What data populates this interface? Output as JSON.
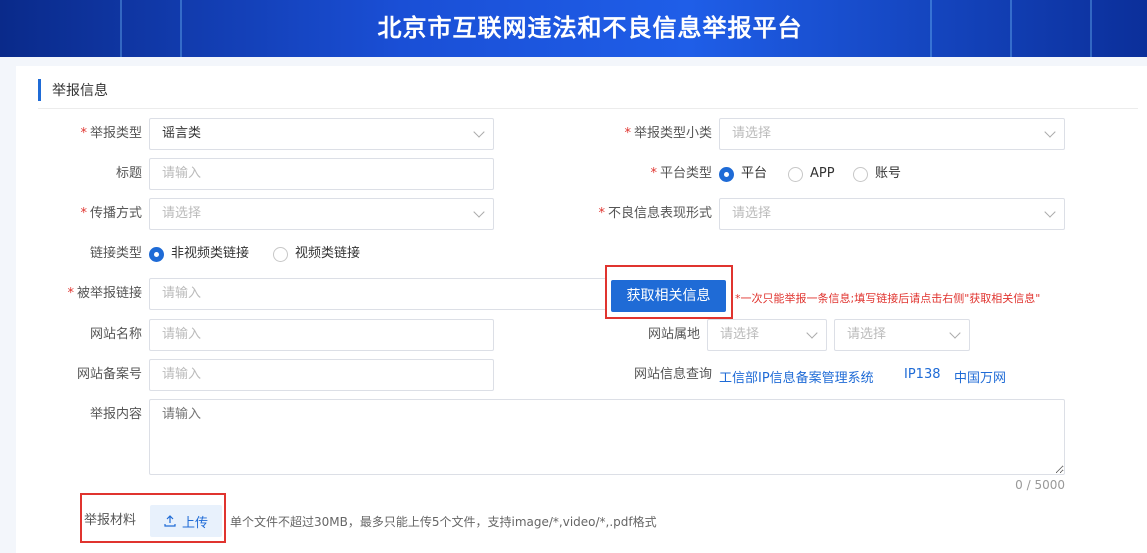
{
  "header": {
    "title": "北京市互联网违法和不良信息举报平台"
  },
  "section": {
    "title": "举报信息"
  },
  "form": {
    "report_type": {
      "label": "举报类型",
      "value": "谣言类"
    },
    "report_subtype": {
      "label": "举报类型小类",
      "placeholder": "请选择"
    },
    "title": {
      "label": "标题",
      "placeholder": "请输入"
    },
    "platform_type": {
      "label": "平台类型",
      "options": [
        "平台",
        "APP",
        "账号"
      ],
      "selected": "平台"
    },
    "spread_method": {
      "label": "传播方式",
      "placeholder": "请选择"
    },
    "bad_info_form": {
      "label": "不良信息表现形式",
      "placeholder": "请选择"
    },
    "link_type": {
      "label": "链接类型",
      "options": [
        "非视频类链接",
        "视频类链接"
      ],
      "selected": "非视频类链接"
    },
    "reported_link": {
      "label": "被举报链接",
      "placeholder": "请输入"
    },
    "fetch_button": "获取相关信息",
    "fetch_note": "*一次只能举报一条信息;填写链接后请点击右侧\"获取相关信息\"",
    "site_name": {
      "label": "网站名称",
      "placeholder": "请输入"
    },
    "site_location": {
      "label": "网站属地",
      "placeholder1": "请选择",
      "placeholder2": "请选择"
    },
    "site_icp": {
      "label": "网站备案号",
      "placeholder": "请输入"
    },
    "site_query": {
      "label": "网站信息查询",
      "links": [
        "工信部IP信息备案管理系统",
        "IP138",
        "中国万网"
      ]
    },
    "content": {
      "label": "举报内容",
      "placeholder": "请输入",
      "counter": "0 / 5000"
    },
    "material": {
      "label": "举报材料",
      "upload_label": "上传",
      "hint": "单个文件不超过30MB，最多只能上传5个文件，支持image/*,video/*,.pdf格式"
    }
  },
  "colors": {
    "accent": "#1f6bd6",
    "required": "#e0342f",
    "highlight": "#e0342f"
  }
}
